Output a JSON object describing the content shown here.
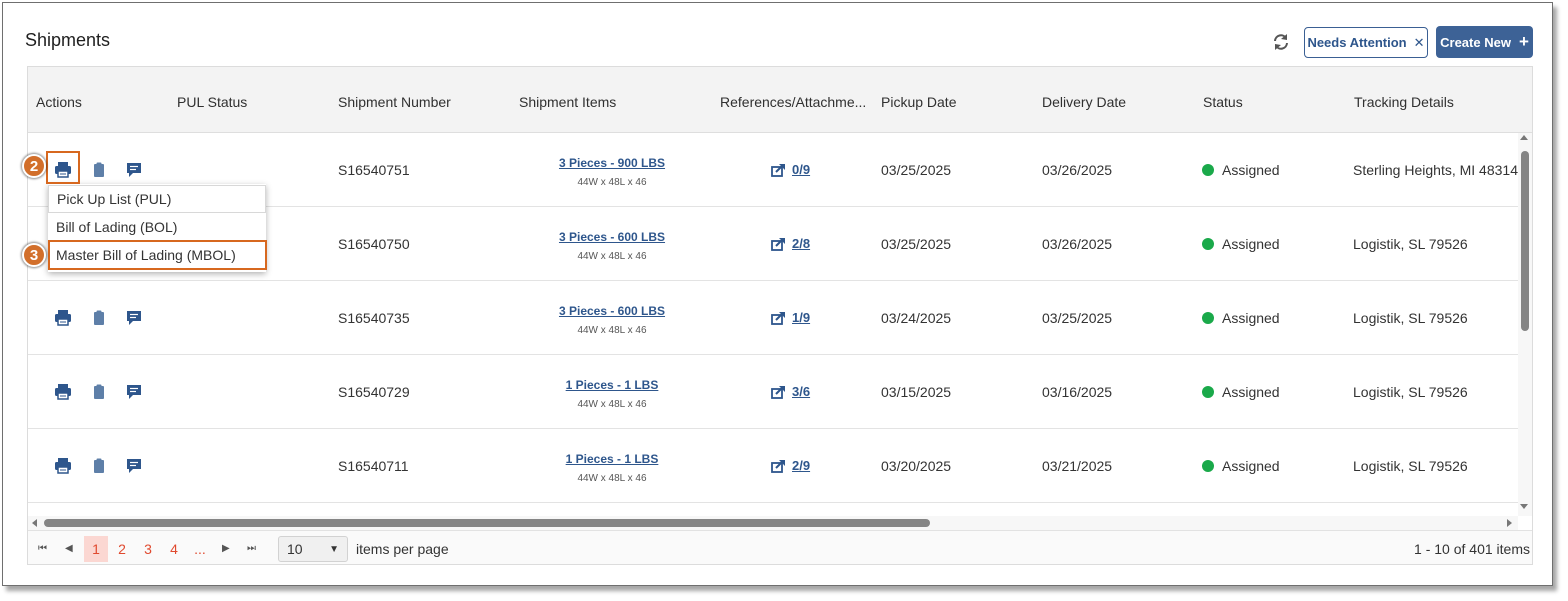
{
  "page": {
    "title": "Shipments"
  },
  "toolbar": {
    "refresh_icon": "refresh-icon",
    "needs_attention_label": "Needs Attention",
    "needs_attention_close": "✕",
    "create_new_label": "Create New",
    "create_new_plus": "+"
  },
  "columns": [
    "Actions",
    "PUL Status",
    "Shipment Number",
    "Shipment Items",
    "References/Attachme...",
    "Pickup Date",
    "Delivery Date",
    "Status",
    "Tracking Details"
  ],
  "rows": [
    {
      "shipment": "S16540751",
      "items": "3 Pieces - 900 LBS",
      "dims": "44W x 48L x 46",
      "refs": "0/9",
      "pickup": "03/25/2025",
      "delivery": "03/26/2025",
      "status": "Assigned",
      "tracking": "Sterling Heights, MI 48314"
    },
    {
      "shipment": "S16540750",
      "items": "3 Pieces - 600 LBS",
      "dims": "44W x 48L x 46",
      "refs": "2/8",
      "pickup": "03/25/2025",
      "delivery": "03/26/2025",
      "status": "Assigned",
      "tracking": "Logistik, SL 79526"
    },
    {
      "shipment": "S16540735",
      "items": "3 Pieces - 600 LBS",
      "dims": "44W x 48L x 46",
      "refs": "1/9",
      "pickup": "03/24/2025",
      "delivery": "03/25/2025",
      "status": "Assigned",
      "tracking": "Logistik, SL 79526"
    },
    {
      "shipment": "S16540729",
      "items": "1 Pieces - 1 LBS",
      "dims": "44W x 48L x 46",
      "refs": "3/6",
      "pickup": "03/15/2025",
      "delivery": "03/16/2025",
      "status": "Assigned",
      "tracking": "Logistik, SL 79526"
    },
    {
      "shipment": "S16540711",
      "items": "1 Pieces - 1 LBS",
      "dims": "44W x 48L x 46",
      "refs": "2/9",
      "pickup": "03/20/2025",
      "delivery": "03/21/2025",
      "status": "Assigned",
      "tracking": "Logistik, SL 79526"
    }
  ],
  "print_menu": [
    "Pick Up List (PUL)",
    "Bill of Lading (BOL)",
    "Master Bill of Lading (MBOL)"
  ],
  "callouts": [
    "2",
    "3"
  ],
  "pager": {
    "pages": [
      "1",
      "2",
      "3",
      "4",
      "..."
    ],
    "page_size": "10",
    "page_size_label": "items per page",
    "info": "1 - 10 of 401 items"
  },
  "colors": {
    "accent": "#3d6296",
    "link": "#2e568c",
    "status_green": "#1aa94a",
    "highlight": "#d7681f",
    "page_active": "#e04a2f"
  }
}
